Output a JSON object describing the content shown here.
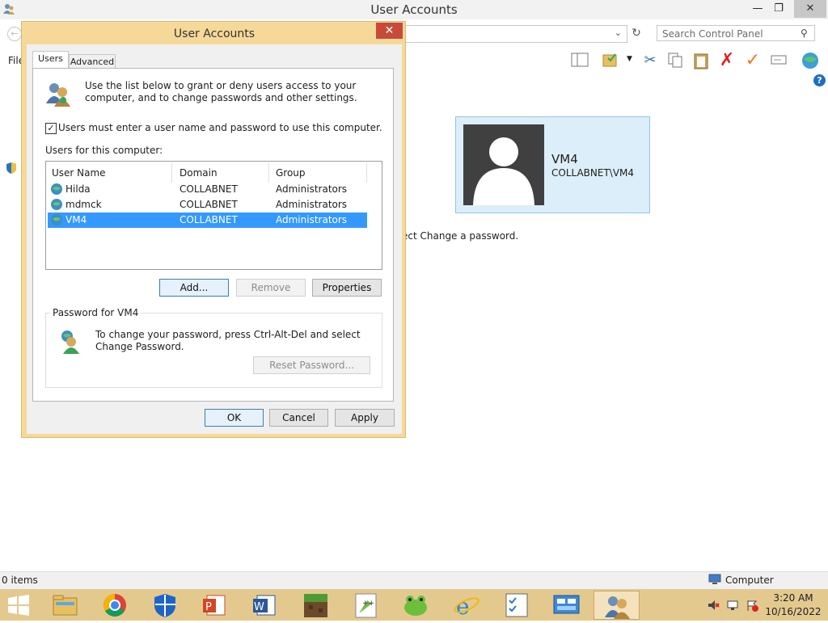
{
  "bg_window": {
    "title": "User Accounts",
    "search_placeholder": "Search Control Panel",
    "menu_file": "File",
    "help_glyph": "?",
    "status_items": "0 items",
    "status_location": "Computer",
    "instruction_fragment": "ect Change a password.",
    "user_tile": {
      "name": "VM4",
      "account": "COLLABNET\\VM4"
    }
  },
  "dialog": {
    "title": "User Accounts",
    "tabs": [
      {
        "label": "Users"
      },
      {
        "label": "Advanced"
      }
    ],
    "intro": "Use the list below to grant or deny users access to your computer, and to change passwords and other settings.",
    "checkbox_label": "Users must enter a user name and password to use this computer.",
    "checkbox_checked": true,
    "list_label": "Users for this computer:",
    "columns": [
      "User Name",
      "Domain",
      "Group"
    ],
    "users": [
      {
        "name": "Hilda",
        "domain": "COLLABNET",
        "group": "Administrators"
      },
      {
        "name": "mdmck",
        "domain": "COLLABNET",
        "group": "Administrators"
      },
      {
        "name": "VM4",
        "domain": "COLLABNET",
        "group": "Administrators",
        "selected": true
      }
    ],
    "buttons": {
      "add": "Add...",
      "remove": "Remove",
      "properties": "Properties"
    },
    "password_group_label": "Password for VM4",
    "password_text": "To change your password, press Ctrl-Alt-Del and select Change Password.",
    "reset_password": "Reset Password...",
    "ok": "OK",
    "cancel": "Cancel",
    "apply": "Apply"
  },
  "taskbar": {
    "apps": [
      {
        "icon": "file-explorer-icon"
      },
      {
        "icon": "chrome-icon"
      },
      {
        "icon": "windows-defender-icon"
      },
      {
        "icon": "powerpoint-icon"
      },
      {
        "icon": "word-icon"
      },
      {
        "icon": "minecraft-icon"
      },
      {
        "icon": "notepad-plus-plus-icon"
      },
      {
        "icon": "frog-app-icon"
      },
      {
        "icon": "internet-explorer-icon"
      },
      {
        "icon": "task-manager-icon"
      },
      {
        "icon": "control-panel-icon"
      },
      {
        "icon": "user-accounts-icon",
        "active": true
      }
    ],
    "clock_time": "3:20 AM",
    "clock_date": "10/16/2022"
  },
  "colors": {
    "dialog_frame": "#f6d898",
    "taskbar": "#e4c98f",
    "selection": "#3399ff",
    "close_button": "#c74a3a"
  }
}
